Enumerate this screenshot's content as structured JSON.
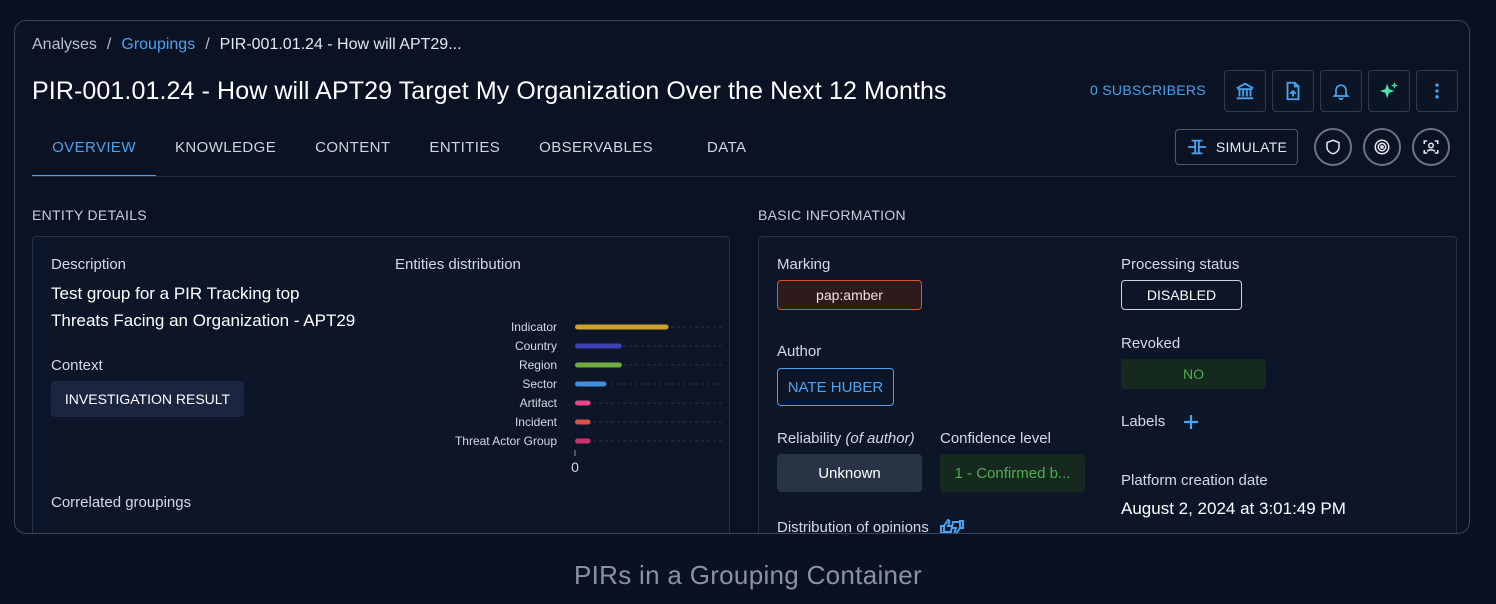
{
  "breadcrumb": {
    "root": "Analyses",
    "sep": "/",
    "link": "Groupings",
    "current": "PIR-001.01.24 - How will APT29..."
  },
  "page_title": "PIR-001.01.24 - How will APT29 Target My Organization Over the Next 12 Months",
  "subscribers": "0 SUBSCRIBERS",
  "toolbar_icons": [
    "bank-icon",
    "file-export-icon",
    "bell-icon",
    "sparkles-icon",
    "more-vertical-icon"
  ],
  "tabs": [
    {
      "label": "OVERVIEW",
      "active": true
    },
    {
      "label": "KNOWLEDGE"
    },
    {
      "label": "CONTENT"
    },
    {
      "label": "ENTITIES"
    },
    {
      "label": "OBSERVABLES"
    },
    {
      "label": "DATA"
    }
  ],
  "simulate_label": "SIMULATE",
  "entity_details": {
    "heading": "ENTITY DETAILS",
    "description_label": "Description",
    "description_line1": "Test group for a PIR Tracking top",
    "description_line2": "Threats Facing an Organization - APT29",
    "context_label": "Context",
    "context_value": "INVESTIGATION RESULT",
    "correlated_label": "Correlated groupings",
    "distribution_label": "Entities distribution"
  },
  "chart_data": {
    "type": "bar",
    "orientation": "horizontal",
    "categories": [
      "Indicator",
      "Country",
      "Region",
      "Sector",
      "Artifact",
      "Incident",
      "Threat Actor Group"
    ],
    "values": [
      6,
      3,
      3,
      2,
      1,
      1,
      1
    ],
    "colors": [
      "#c9a227",
      "#3f3fb5",
      "#6fae3c",
      "#3f8ee0",
      "#e8468a",
      "#e0504a",
      "#d0306e"
    ],
    "xlim": [
      0,
      10
    ],
    "xticks": [
      "0",
      "10"
    ],
    "grid": true
  },
  "basic_info": {
    "heading": "BASIC INFORMATION",
    "marking_label": "Marking",
    "marking_value": "pap:amber",
    "author_label": "Author",
    "author_value": "NATE HUBER",
    "reliability_label": "Reliability",
    "reliability_qualifier": "(of author)",
    "reliability_value": "Unknown",
    "confidence_label": "Confidence level",
    "confidence_value": "1 - Confirmed b...",
    "opinions_label": "Distribution of opinions",
    "processing_label": "Processing status",
    "processing_value": "DISABLED",
    "revoked_label": "Revoked",
    "revoked_value": "NO",
    "labels_label": "Labels",
    "creation_label": "Platform creation date",
    "creation_value": "August 2, 2024 at 3:01:49 PM"
  },
  "caption": "PIRs in a Grouping Container",
  "colors": {
    "accent": "#4aa3f0",
    "amber": "#d9542b",
    "success": "#4caf50",
    "background": "#0a1223"
  }
}
